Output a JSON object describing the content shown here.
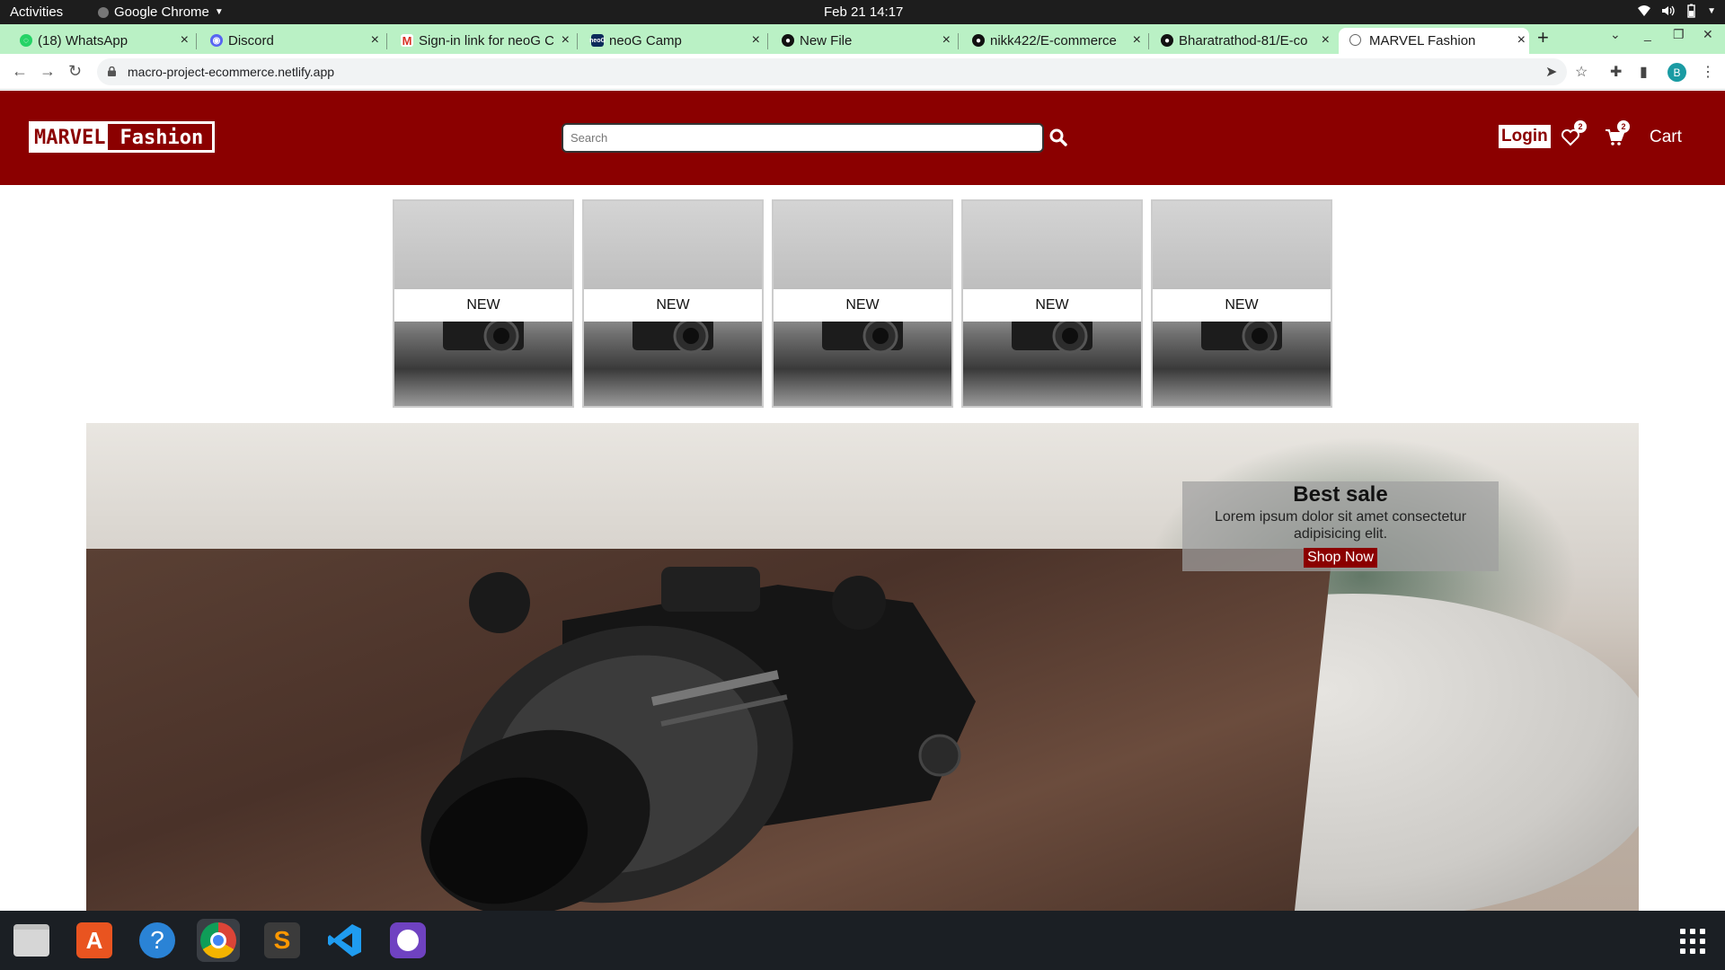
{
  "topbar": {
    "activities": "Activities",
    "app": "Google Chrome",
    "clock": "Feb 21  14:17"
  },
  "tabs": [
    {
      "title": "(18) WhatsApp",
      "icon": "whatsapp-icon",
      "color": "#25d366"
    },
    {
      "title": "Discord",
      "icon": "discord-icon",
      "color": "#5865f2"
    },
    {
      "title": "Sign-in link for neoG C",
      "icon": "gmail-icon",
      "color": "#d93025"
    },
    {
      "title": "neoG Camp",
      "icon": "neog-icon",
      "color": "#0b2a5a"
    },
    {
      "title": "New File",
      "icon": "github-icon",
      "color": "#111111"
    },
    {
      "title": "nikk422/E-commerce",
      "icon": "github-icon",
      "color": "#111111"
    },
    {
      "title": "Bharatrathod-81/E-co",
      "icon": "github-icon",
      "color": "#111111"
    },
    {
      "title": "MARVEL Fashion",
      "icon": "globe-icon",
      "color": "#666666"
    }
  ],
  "omnibox": {
    "url": "macro-project-ecommerce.netlify.app"
  },
  "profile_initial": "B",
  "site": {
    "logo_part1": "MARVEL",
    "logo_part2": "Fashion",
    "search_placeholder": "Search",
    "login": "Login",
    "wishlist_count": "2",
    "cart_count": "2",
    "cart_label": "Cart",
    "brand_color": "#8b0000"
  },
  "categories": [
    {
      "label": "NEW"
    },
    {
      "label": "NEW"
    },
    {
      "label": "NEW"
    },
    {
      "label": "NEW"
    },
    {
      "label": "NEW"
    }
  ],
  "hero": {
    "title": "Best sale",
    "text": "Lorem ipsum dolor sit amet consectetur adipisicing elit.",
    "button": "Shop Now"
  },
  "dock": [
    {
      "name": "files-icon"
    },
    {
      "name": "app-center-icon"
    },
    {
      "name": "help-icon"
    },
    {
      "name": "chrome-icon"
    },
    {
      "name": "sublime-text-icon"
    },
    {
      "name": "vscode-icon"
    },
    {
      "name": "github-desktop-icon"
    }
  ]
}
